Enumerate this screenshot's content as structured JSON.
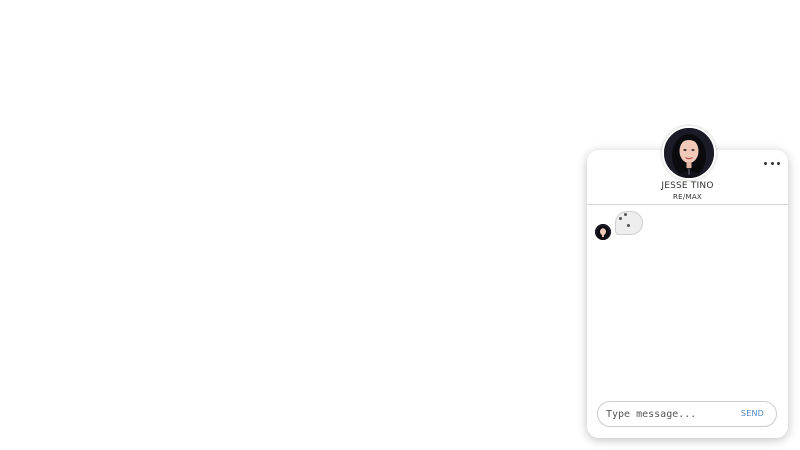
{
  "chat": {
    "agent": {
      "name": "JESSE TINO",
      "company": "RE/MAX",
      "avatar": "woman-portrait-photo"
    },
    "menu_icon": "more-horizontal-icon",
    "messages": [
      {
        "type": "typing-indicator",
        "avatar": "woman-portrait-photo"
      }
    ],
    "input": {
      "placeholder": "Type message...",
      "value": ""
    },
    "send_label": "SEND",
    "colors": {
      "accent": "#4a86c5",
      "bubble": "#eeeeee",
      "divider": "#d4d4d4"
    }
  }
}
